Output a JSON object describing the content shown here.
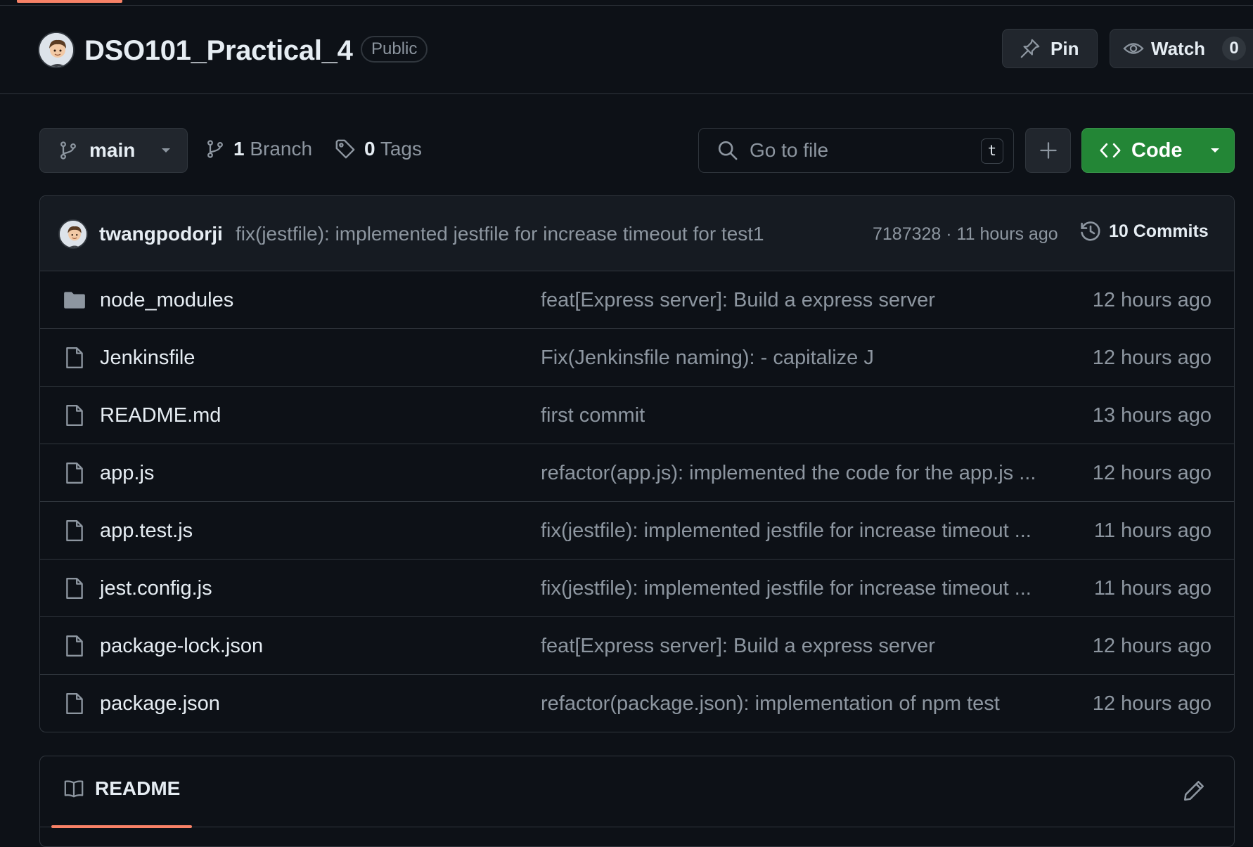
{
  "repo": {
    "name": "DSO101_Practical_4",
    "visibility": "Public"
  },
  "header_actions": {
    "pin_label": "Pin",
    "watch_label": "Watch",
    "watch_count": "0"
  },
  "toolbar": {
    "branch_name": "main",
    "branch_count": "1",
    "branch_label": "Branch",
    "tag_count": "0",
    "tag_label": "Tags",
    "search_placeholder": "Go to file",
    "search_shortcut": "t",
    "code_label": "Code",
    "accent_color": "#238636"
  },
  "latest_commit": {
    "author": "twangpodorji",
    "message": "fix(jestfile): implemented jestfile for increase timeout for test1",
    "meta": "7187328 · 11 hours ago",
    "commits_label": "10 Commits"
  },
  "files": [
    {
      "icon": "folder-icon",
      "name": "node_modules",
      "commit": "feat[Express server]: Build a express server",
      "age": "12 hours ago"
    },
    {
      "icon": "file-icon",
      "name": "Jenkinsfile",
      "commit": "Fix(Jenkinsfile naming): - capitalize J",
      "age": "12 hours ago"
    },
    {
      "icon": "file-icon",
      "name": "README.md",
      "commit": "first commit",
      "age": "13 hours ago"
    },
    {
      "icon": "file-icon",
      "name": "app.js",
      "commit": "refactor(app.js): implemented the code for the app.js ...",
      "age": "12 hours ago"
    },
    {
      "icon": "file-icon",
      "name": "app.test.js",
      "commit": "fix(jestfile): implemented jestfile for increase timeout ...",
      "age": "11 hours ago"
    },
    {
      "icon": "file-icon",
      "name": "jest.config.js",
      "commit": "fix(jestfile): implemented jestfile for increase timeout ...",
      "age": "11 hours ago"
    },
    {
      "icon": "file-icon",
      "name": "package-lock.json",
      "commit": "feat[Express server]: Build a express server",
      "age": "12 hours ago"
    },
    {
      "icon": "file-icon",
      "name": "package.json",
      "commit": "refactor(package.json): implementation of npm test",
      "age": "12 hours ago"
    }
  ],
  "readme": {
    "tab_label": "README",
    "accent_color": "#f78166"
  }
}
